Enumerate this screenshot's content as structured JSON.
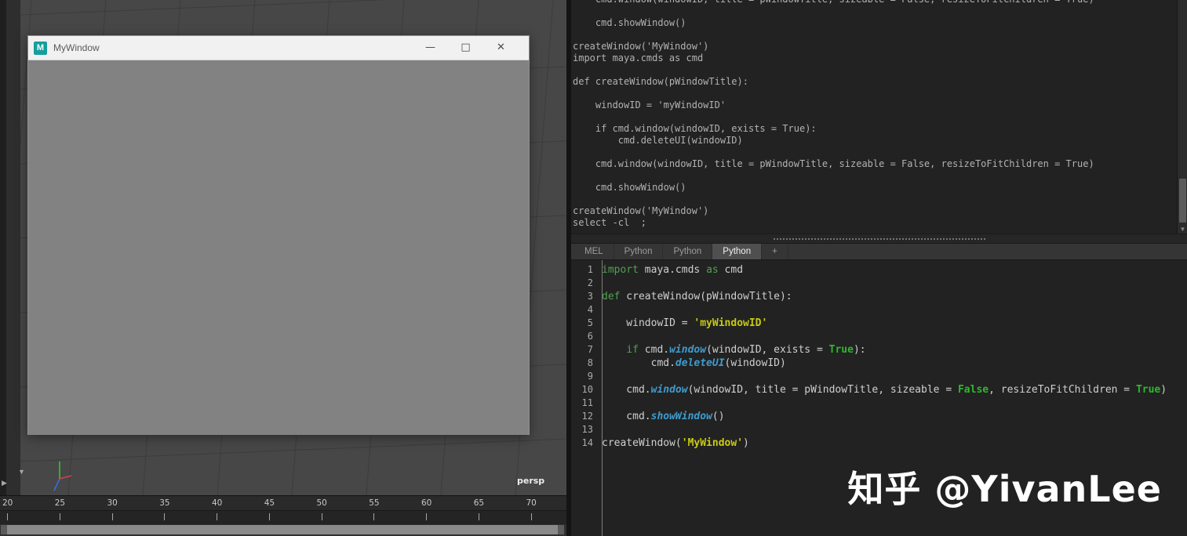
{
  "maya_window": {
    "title": "MyWindow",
    "icon_letter": "M",
    "minimize_icon": "—",
    "maximize_icon": "□",
    "close_icon": "✕"
  },
  "viewport": {
    "camera_label": "persp"
  },
  "icons": {
    "panel_collapse": "▼",
    "panel_expand": "▶",
    "scroll_down": "▼"
  },
  "timeline": {
    "ticks": [
      "20",
      "25",
      "30",
      "35",
      "40",
      "45",
      "50",
      "55",
      "60",
      "65",
      "70"
    ]
  },
  "script_editor": {
    "history_lines": [
      "    cmd.window(windowID, title = pWindowTitle, sizeable = False, resizeToFitChildren = True)",
      "",
      "    cmd.showWindow()",
      "",
      "createWindow('MyWindow')",
      "import maya.cmds as cmd",
      "",
      "def createWindow(pWindowTitle):",
      "",
      "    windowID = 'myWindowID'",
      "",
      "    if cmd.window(windowID, exists = True):",
      "        cmd.deleteUI(windowID)",
      "",
      "    cmd.window(windowID, title = pWindowTitle, sizeable = False, resizeToFitChildren = True)",
      "",
      "    cmd.showWindow()",
      "",
      "createWindow('MyWindow')",
      "select -cl  ;"
    ],
    "tabs": [
      {
        "label": "MEL",
        "active": false
      },
      {
        "label": "Python",
        "active": false
      },
      {
        "label": "Python",
        "active": false
      },
      {
        "label": "Python",
        "active": true
      },
      {
        "label": "+",
        "active": false
      }
    ],
    "code_lines": [
      {
        "n": "1",
        "tokens": [
          [
            "kw",
            "import"
          ],
          [
            "pl",
            " maya.cmds "
          ],
          [
            "kw",
            "as"
          ],
          [
            "pl",
            " cmd"
          ]
        ]
      },
      {
        "n": "2",
        "tokens": []
      },
      {
        "n": "3",
        "tokens": [
          [
            "kw",
            "def"
          ],
          [
            "pl",
            " createWindow(pWindowTitle):"
          ]
        ]
      },
      {
        "n": "4",
        "tokens": []
      },
      {
        "n": "5",
        "tokens": [
          [
            "pl",
            "    windowID = "
          ],
          [
            "str",
            "'myWindowID'"
          ]
        ]
      },
      {
        "n": "6",
        "tokens": []
      },
      {
        "n": "7",
        "tokens": [
          [
            "pl",
            "    "
          ],
          [
            "kw",
            "if"
          ],
          [
            "pl",
            " cmd."
          ],
          [
            "fn",
            "window"
          ],
          [
            "pl",
            "(windowID, exists = "
          ],
          [
            "bool",
            "True"
          ],
          [
            "pl",
            "):"
          ]
        ]
      },
      {
        "n": "8",
        "tokens": [
          [
            "pl",
            "        cmd."
          ],
          [
            "fn",
            "deleteUI"
          ],
          [
            "pl",
            "(windowID)"
          ]
        ]
      },
      {
        "n": "9",
        "tokens": []
      },
      {
        "n": "10",
        "tokens": [
          [
            "pl",
            "    cmd."
          ],
          [
            "fn",
            "window"
          ],
          [
            "pl",
            "(windowID, title = pWindowTitle, sizeable = "
          ],
          [
            "bool",
            "False"
          ],
          [
            "pl",
            ", resizeToFitChildren = "
          ],
          [
            "bool",
            "True"
          ],
          [
            "pl",
            ")"
          ]
        ]
      },
      {
        "n": "11",
        "tokens": []
      },
      {
        "n": "12",
        "tokens": [
          [
            "pl",
            "    cmd."
          ],
          [
            "fn",
            "showWindow"
          ],
          [
            "pl",
            "()"
          ]
        ]
      },
      {
        "n": "13",
        "tokens": []
      },
      {
        "n": "14",
        "tokens": [
          [
            "pl",
            "createWindow("
          ],
          [
            "str",
            "'MyWindow'"
          ],
          [
            "pl",
            ")"
          ]
        ]
      }
    ]
  },
  "watermark": "知乎 @YivanLee"
}
